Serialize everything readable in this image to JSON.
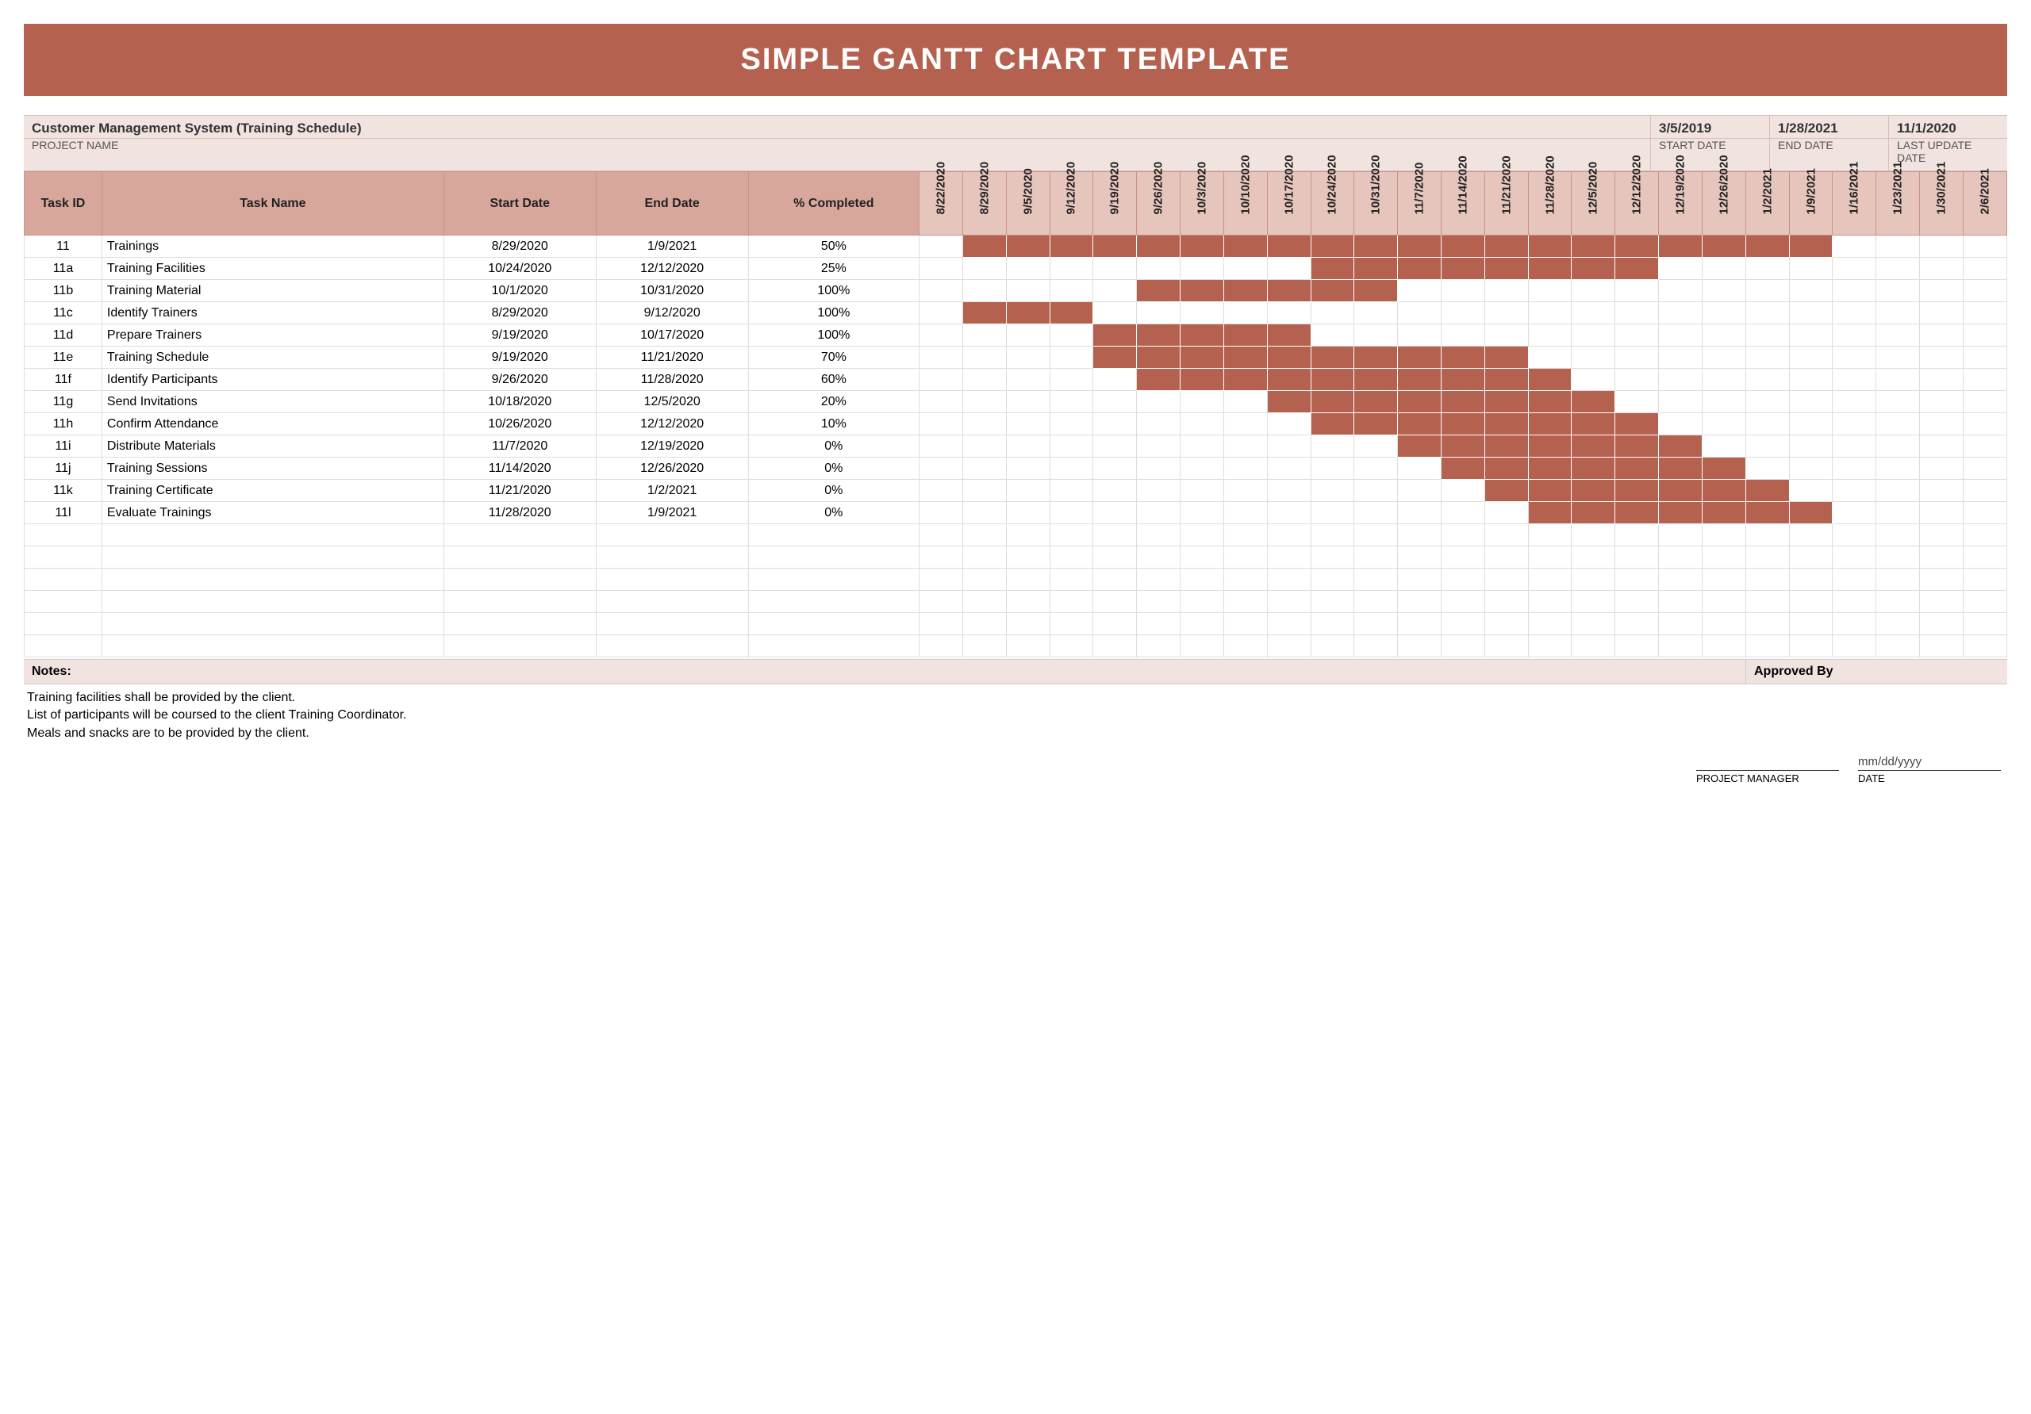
{
  "title": "SIMPLE GANTT CHART TEMPLATE",
  "project_name_label": "PROJECT NAME",
  "project_name": "Customer Management System (Training Schedule)",
  "meta": {
    "start_date": {
      "label": "START DATE",
      "value": "3/5/2019"
    },
    "end_date": {
      "label": "END DATE",
      "value": "1/28/2021"
    },
    "last_update": {
      "label": "LAST UPDATE DATE",
      "value": "11/1/2020"
    }
  },
  "columns": {
    "task_id": "Task ID",
    "task_name": "Task Name",
    "start_date": "Start Date",
    "end_date": "End Date",
    "pct": "% Completed"
  },
  "timeline_dates": [
    "8/22/2020",
    "8/29/2020",
    "9/5/2020",
    "9/12/2020",
    "9/19/2020",
    "9/26/2020",
    "10/3/2020",
    "10/10/2020",
    "10/17/2020",
    "10/24/2020",
    "10/31/2020",
    "11/7/2020",
    "11/14/2020",
    "11/21/2020",
    "11/28/2020",
    "12/5/2020",
    "12/12/2020",
    "12/19/2020",
    "12/26/2020",
    "1/2/2021",
    "1/9/2021",
    "1/16/2021",
    "1/23/2021",
    "1/30/2021",
    "2/6/2021"
  ],
  "tasks": [
    {
      "id": "11",
      "name": "Trainings",
      "start": "8/29/2020",
      "end": "1/9/2021",
      "pct": "50%",
      "bar": [
        1,
        20
      ]
    },
    {
      "id": "11a",
      "name": "Training Facilities",
      "start": "10/24/2020",
      "end": "12/12/2020",
      "pct": "25%",
      "bar": [
        9,
        16
      ]
    },
    {
      "id": "11b",
      "name": "Training Material",
      "start": "10/1/2020",
      "end": "10/31/2020",
      "pct": "100%",
      "bar": [
        5,
        10
      ]
    },
    {
      "id": "11c",
      "name": "Identify Trainers",
      "start": "8/29/2020",
      "end": "9/12/2020",
      "pct": "100%",
      "bar": [
        1,
        3
      ]
    },
    {
      "id": "11d",
      "name": "Prepare Trainers",
      "start": "9/19/2020",
      "end": "10/17/2020",
      "pct": "100%",
      "bar": [
        4,
        8
      ]
    },
    {
      "id": "11e",
      "name": "Training Schedule",
      "start": "9/19/2020",
      "end": "11/21/2020",
      "pct": "70%",
      "bar": [
        4,
        13
      ]
    },
    {
      "id": "11f",
      "name": "Identify Participants",
      "start": "9/26/2020",
      "end": "11/28/2020",
      "pct": "60%",
      "bar": [
        5,
        14
      ]
    },
    {
      "id": "11g",
      "name": "Send Invitations",
      "start": "10/18/2020",
      "end": "12/5/2020",
      "pct": "20%",
      "bar": [
        8,
        15
      ]
    },
    {
      "id": "11h",
      "name": "Confirm Attendance",
      "start": "10/26/2020",
      "end": "12/12/2020",
      "pct": "10%",
      "bar": [
        9,
        16
      ]
    },
    {
      "id": "11i",
      "name": "Distribute Materials",
      "start": "11/7/2020",
      "end": "12/19/2020",
      "pct": "0%",
      "bar": [
        11,
        17
      ]
    },
    {
      "id": "11j",
      "name": "Training Sessions",
      "start": "11/14/2020",
      "end": "12/26/2020",
      "pct": "0%",
      "bar": [
        12,
        18
      ]
    },
    {
      "id": "11k",
      "name": "Training Certificate",
      "start": "11/21/2020",
      "end": "1/2/2021",
      "pct": "0%",
      "bar": [
        13,
        19
      ]
    },
    {
      "id": "11l",
      "name": "Evaluate Trainings",
      "start": "11/28/2020",
      "end": "1/9/2021",
      "pct": "0%",
      "bar": [
        14,
        20
      ]
    }
  ],
  "empty_rows": 6,
  "footer": {
    "notes_label": "Notes:",
    "approved_by_label": "Approved By",
    "notes": [
      "Training facilities shall be provided by the client.",
      "List of participants will be coursed to the client Training Coordinator.",
      "Meals and snacks are to be provided by the client."
    ],
    "sign": {
      "pm_label": "PROJECT MANAGER",
      "date_label": "DATE",
      "date_placeholder": "mm/dd/yyyy"
    }
  },
  "chart_data": {
    "type": "gantt",
    "title": "SIMPLE GANTT CHART TEMPLATE",
    "x_unit": "week",
    "x_categories": [
      "8/22/2020",
      "8/29/2020",
      "9/5/2020",
      "9/12/2020",
      "9/19/2020",
      "9/26/2020",
      "10/3/2020",
      "10/10/2020",
      "10/17/2020",
      "10/24/2020",
      "10/31/2020",
      "11/7/2020",
      "11/14/2020",
      "11/21/2020",
      "11/28/2020",
      "12/5/2020",
      "12/12/2020",
      "12/19/2020",
      "12/26/2020",
      "1/2/2021",
      "1/9/2021",
      "1/16/2021",
      "1/23/2021",
      "1/30/2021",
      "2/6/2021"
    ],
    "series": [
      {
        "id": "11",
        "name": "Trainings",
        "start": "8/29/2020",
        "end": "1/9/2021",
        "pct_completed": 50
      },
      {
        "id": "11a",
        "name": "Training Facilities",
        "start": "10/24/2020",
        "end": "12/12/2020",
        "pct_completed": 25
      },
      {
        "id": "11b",
        "name": "Training Material",
        "start": "10/1/2020",
        "end": "10/31/2020",
        "pct_completed": 100
      },
      {
        "id": "11c",
        "name": "Identify Trainers",
        "start": "8/29/2020",
        "end": "9/12/2020",
        "pct_completed": 100
      },
      {
        "id": "11d",
        "name": "Prepare Trainers",
        "start": "9/19/2020",
        "end": "10/17/2020",
        "pct_completed": 100
      },
      {
        "id": "11e",
        "name": "Training Schedule",
        "start": "9/19/2020",
        "end": "11/21/2020",
        "pct_completed": 70
      },
      {
        "id": "11f",
        "name": "Identify Participants",
        "start": "9/26/2020",
        "end": "11/28/2020",
        "pct_completed": 60
      },
      {
        "id": "11g",
        "name": "Send Invitations",
        "start": "10/18/2020",
        "end": "12/5/2020",
        "pct_completed": 20
      },
      {
        "id": "11h",
        "name": "Confirm Attendance",
        "start": "10/26/2020",
        "end": "12/12/2020",
        "pct_completed": 10
      },
      {
        "id": "11i",
        "name": "Distribute Materials",
        "start": "11/7/2020",
        "end": "12/19/2020",
        "pct_completed": 0
      },
      {
        "id": "11j",
        "name": "Training Sessions",
        "start": "11/14/2020",
        "end": "12/26/2020",
        "pct_completed": 0
      },
      {
        "id": "11k",
        "name": "Training Certificate",
        "start": "11/21/2020",
        "end": "1/2/2021",
        "pct_completed": 0
      },
      {
        "id": "11l",
        "name": "Evaluate Trainings",
        "start": "11/28/2020",
        "end": "1/9/2021",
        "pct_completed": 0
      }
    ],
    "bar_color": "#b5614f"
  }
}
